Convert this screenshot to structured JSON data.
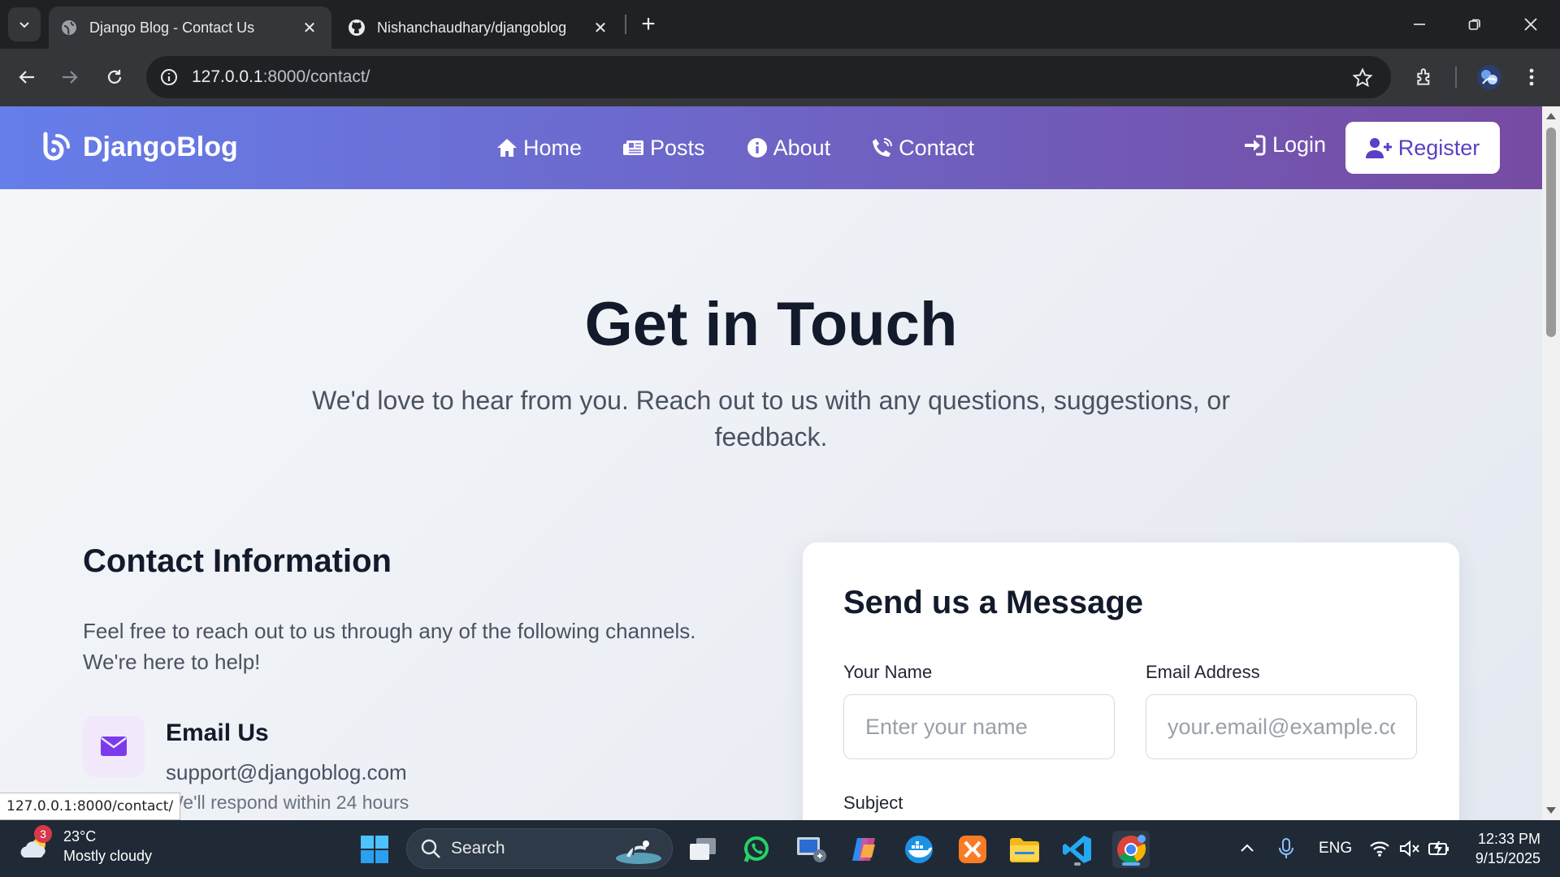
{
  "browser": {
    "tabs": [
      {
        "title": "Django Blog - Contact Us",
        "active": true
      },
      {
        "title": "Nishanchaudhary/djangoblog",
        "active": false
      }
    ],
    "url_host": "127.0.0.1",
    "url_rest": ":8000/contact/",
    "status_url": "127.0.0.1:8000/contact/"
  },
  "site": {
    "brand": "DjangoBlog",
    "nav": {
      "home": "Home",
      "posts": "Posts",
      "about": "About",
      "contact": "Contact",
      "login": "Login",
      "register": "Register"
    },
    "colors": {
      "nav_gradient_start": "#667eea",
      "nav_gradient_end": "#764ba2",
      "accent": "#7c3aed"
    }
  },
  "hero": {
    "title": "Get in Touch",
    "subtitle": "We'd love to hear from you. Reach out to us with any questions, suggestions, or feedback."
  },
  "contact_info": {
    "title": "Contact Information",
    "description": "Feel free to reach out to us through any of the following channels. We're here to help!",
    "email": {
      "title": "Email Us",
      "address": "support@djangoblog.com",
      "note": "We'll respond within 24 hours"
    }
  },
  "form": {
    "title": "Send us a Message",
    "name_label": "Your Name",
    "name_placeholder": "Enter your name",
    "email_label": "Email Address",
    "email_placeholder": "your.email@example.com",
    "subject_label": "Subject"
  },
  "taskbar": {
    "weather_badge": "3",
    "temperature": "23°C",
    "condition": "Mostly cloudy",
    "search": "Search",
    "language": "ENG",
    "time": "12:33 PM",
    "date": "9/15/2025"
  }
}
